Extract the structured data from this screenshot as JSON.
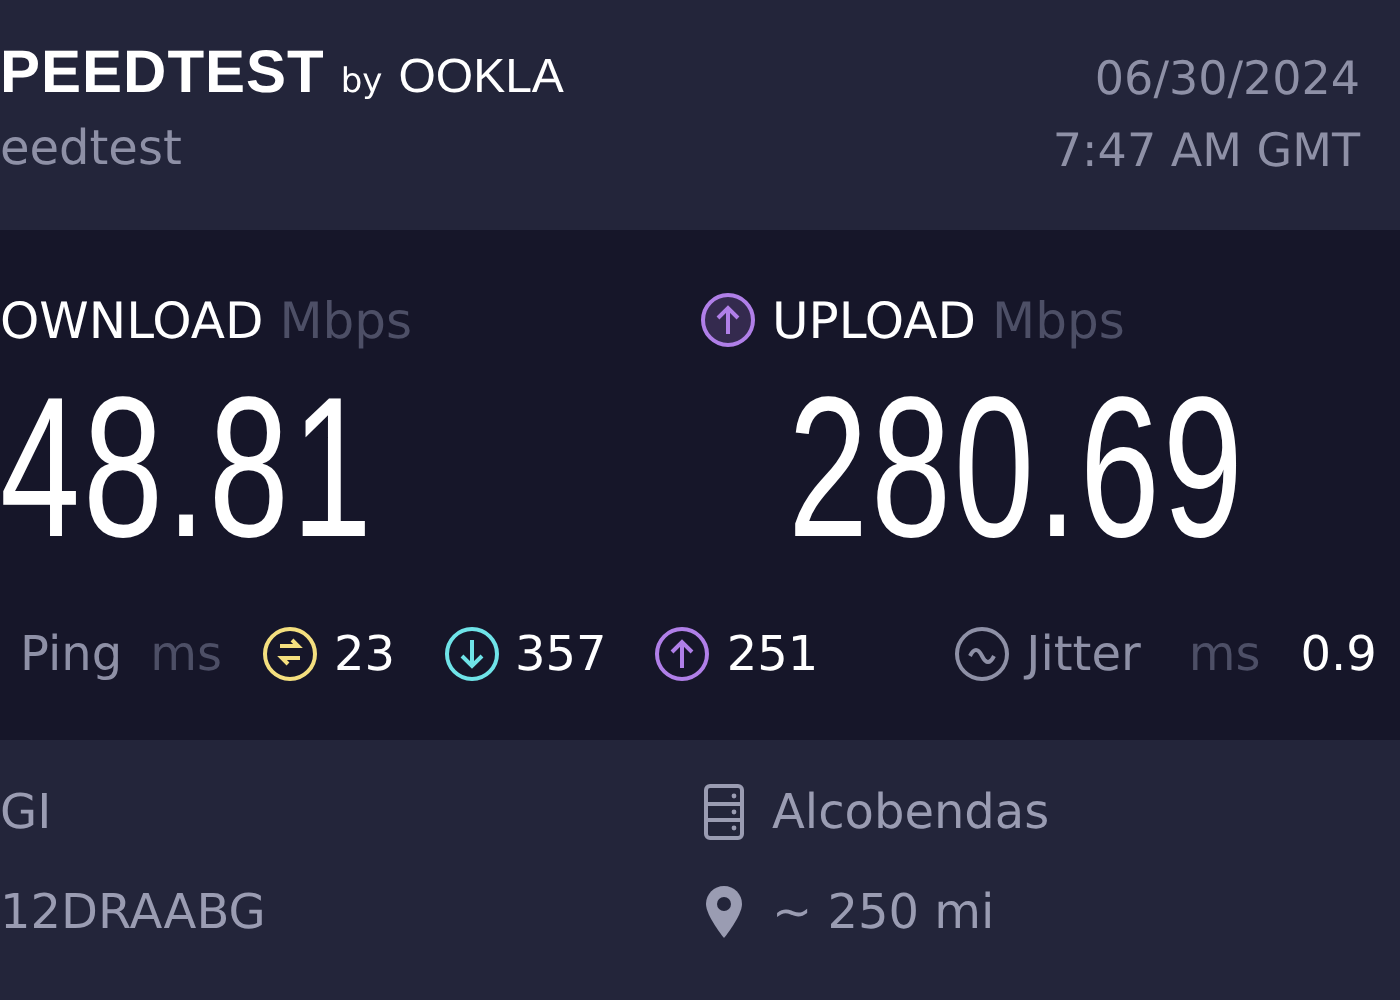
{
  "header": {
    "brand": "PEEDTEST",
    "brand_by": "by",
    "brand_maker": "OOKLA",
    "subtitle": "eedtest",
    "date": "06/30/2024",
    "time": "7:47 AM GMT"
  },
  "download": {
    "label": "OWNLOAD",
    "unit": "Mbps",
    "value": "48.81"
  },
  "upload": {
    "label": "UPLOAD",
    "unit": "Mbps",
    "value": "280.69"
  },
  "ping": {
    "label": "Ping",
    "unit": "ms",
    "metrics": [
      {
        "kind": "idle",
        "value": "23",
        "color": "#f4df7f"
      },
      {
        "kind": "download",
        "value": "357",
        "color": "#6fe3e8"
      },
      {
        "kind": "upload",
        "value": "251",
        "color": "#b07fe8"
      }
    ]
  },
  "jitter": {
    "label": "Jitter",
    "unit": "ms",
    "value": "0.9"
  },
  "provider": {
    "name": "GI",
    "detail": "12DRAABG"
  },
  "server": {
    "name": "Alcobendas",
    "distance": "~ 250 mi"
  }
}
